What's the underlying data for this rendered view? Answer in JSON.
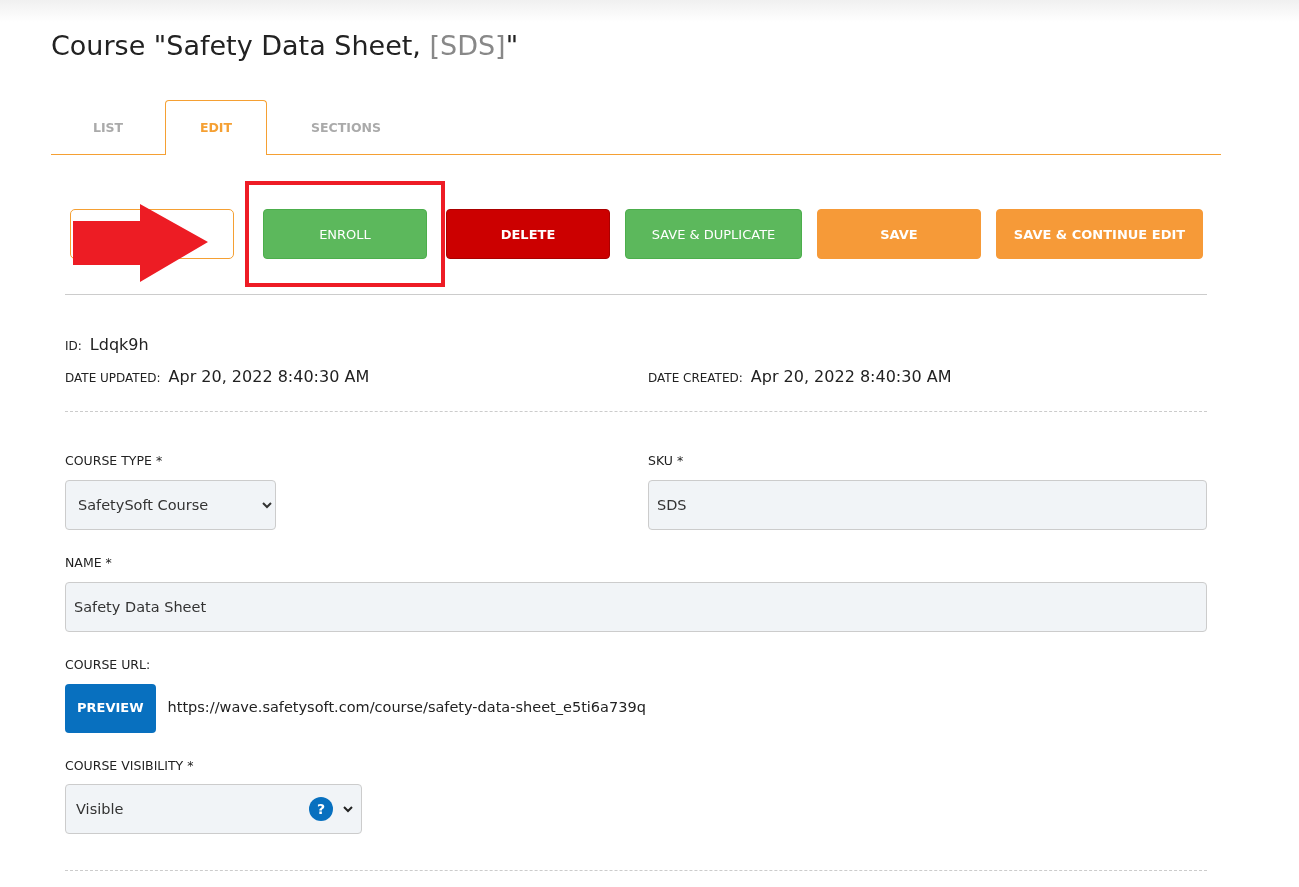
{
  "title": {
    "text": "Course \"Safety Data Sheet, ",
    "code": "[SDS]",
    "close": "\""
  },
  "tabs": [
    {
      "label": "LIST",
      "selected": false
    },
    {
      "label": "EDIT",
      "selected": true
    },
    {
      "label": "SECTIONS",
      "selected": false
    }
  ],
  "toolbar": {
    "arrow_annotation": true,
    "buttons": [
      {
        "label": "ENROLL",
        "kind": "success",
        "highlighted": true
      },
      {
        "label": "DELETE",
        "kind": "danger",
        "highlighted": false
      },
      {
        "label": "SAVE & DUPLICATE",
        "kind": "success",
        "highlighted": false
      },
      {
        "label": "SAVE",
        "kind": "warning",
        "highlighted": false
      },
      {
        "label": "SAVE & CONTINUE EDIT",
        "kind": "warning",
        "highlighted": false
      }
    ]
  },
  "meta": {
    "id_label": "ID:",
    "id": "Ldqk9h",
    "updated_label": "DATE UPDATED:",
    "updated": "Apr 20, 2022 8:40:30 AM",
    "created_label": "DATE CREATED:",
    "created": "Apr 20, 2022 8:40:30 AM"
  },
  "form": {
    "course_type": {
      "label": "COURSE TYPE *",
      "value": "SafetySoft Course"
    },
    "sku": {
      "label": "SKU *",
      "value": "SDS"
    },
    "name": {
      "label": "NAME *",
      "value": "Safety Data Sheet"
    },
    "course_url": {
      "label": "COURSE URL:",
      "button": "PREVIEW",
      "url": "https://wave.safetysoft.com/course/safety-data-sheet_e5ti6a739q"
    },
    "visibility": {
      "label": "COURSE VISIBILITY *",
      "value": "Visible",
      "help": "?"
    }
  }
}
